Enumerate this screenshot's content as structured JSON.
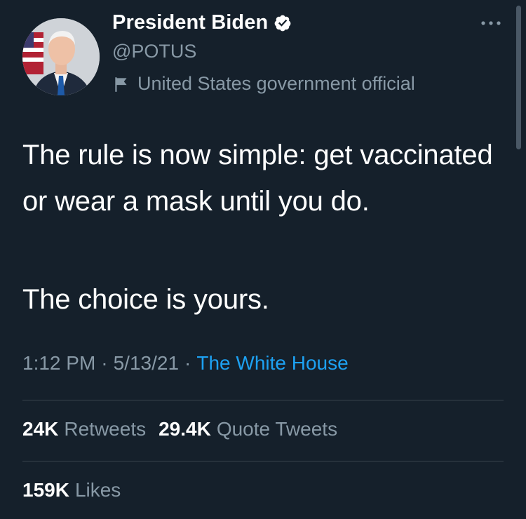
{
  "author": {
    "display_name": "President Biden",
    "handle": "@POTUS",
    "label": "United States government official"
  },
  "tweet": {
    "text": "The rule is now simple: get vaccinated or wear a mask until you do.",
    "text2": "The choice is yours."
  },
  "meta": {
    "time": "1:12 PM",
    "sep1": "·",
    "date": "5/13/21",
    "sep2": "·",
    "source": "The White House"
  },
  "stats": {
    "retweets_count": "24K",
    "retweets_label": "Retweets",
    "quotes_count": "29.4K",
    "quotes_label": "Quote Tweets",
    "likes_count": "159K",
    "likes_label": "Likes"
  },
  "colors": {
    "background": "#15202b",
    "primary_text": "#ffffff",
    "secondary_text": "#8899a6",
    "accent": "#1da1f2",
    "divider": "#38444d"
  },
  "icons": [
    "verified-badge-icon",
    "government-flag-icon",
    "more-options-icon"
  ]
}
